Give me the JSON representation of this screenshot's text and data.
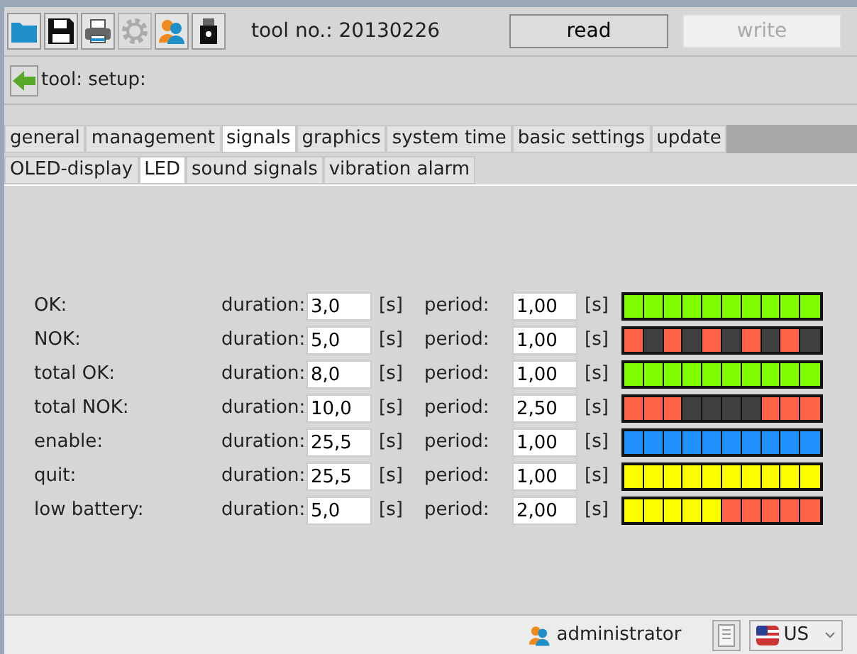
{
  "toolbar": {
    "buttons": [
      {
        "kind": "folder",
        "disabled": false
      },
      {
        "kind": "save",
        "disabled": false
      },
      {
        "kind": "print",
        "disabled": false
      },
      {
        "kind": "gear",
        "disabled": true
      },
      {
        "kind": "user",
        "disabled": false
      },
      {
        "kind": "usb",
        "disabled": false
      }
    ],
    "tool_no": "tool no.: 20130226",
    "actions": [
      {
        "label": "read",
        "disabled": false
      },
      {
        "label": "write",
        "disabled": true
      }
    ]
  },
  "breadcrumb": "tool: setup:",
  "tabs": [
    {
      "label": "general",
      "selected": false
    },
    {
      "label": "management",
      "selected": false
    },
    {
      "label": "signals",
      "selected": true
    },
    {
      "label": "graphics",
      "selected": false
    },
    {
      "label": "system time",
      "selected": false
    },
    {
      "label": "basic settings",
      "selected": false
    },
    {
      "label": "update",
      "selected": false
    }
  ],
  "subtabs": [
    {
      "label": "OLED-display",
      "selected": false
    },
    {
      "label": "LED",
      "selected": true
    },
    {
      "label": "sound signals",
      "selected": false
    },
    {
      "label": "vibration alarm",
      "selected": false
    }
  ],
  "signals": [
    {
      "name": "OK:",
      "duration_label": "duration:",
      "duration": "3,0",
      "duration_unit": "[s]",
      "period_label": "period:",
      "period": "1,00",
      "period_unit": "[s]",
      "cells": [
        {
          "color": "#7fff00"
        },
        {
          "color": "#7fff00"
        },
        {
          "color": "#7fff00"
        },
        {
          "color": "#7fff00"
        },
        {
          "color": "#7fff00"
        },
        {
          "color": "#7fff00"
        },
        {
          "color": "#7fff00"
        },
        {
          "color": "#7fff00"
        },
        {
          "color": "#7fff00"
        },
        {
          "color": "#7fff00"
        }
      ]
    },
    {
      "name": "NOK:",
      "duration_label": "duration:",
      "duration": "5,0",
      "duration_unit": "[s]",
      "period_label": "period:",
      "period": "1,00",
      "period_unit": "[s]",
      "cells": [
        {
          "color": "#ff6347"
        },
        {
          "color": "#404040"
        },
        {
          "color": "#ff6347"
        },
        {
          "color": "#404040"
        },
        {
          "color": "#ff6347"
        },
        {
          "color": "#404040"
        },
        {
          "color": "#ff6347"
        },
        {
          "color": "#404040"
        },
        {
          "color": "#ff6347"
        },
        {
          "color": "#404040"
        }
      ]
    },
    {
      "name": "total OK:",
      "duration_label": "duration:",
      "duration": "8,0",
      "duration_unit": "[s]",
      "period_label": "period:",
      "period": "1,00",
      "period_unit": "[s]",
      "cells": [
        {
          "color": "#7fff00"
        },
        {
          "color": "#7fff00"
        },
        {
          "color": "#7fff00"
        },
        {
          "color": "#7fff00"
        },
        {
          "color": "#7fff00"
        },
        {
          "color": "#7fff00"
        },
        {
          "color": "#7fff00"
        },
        {
          "color": "#7fff00"
        },
        {
          "color": "#7fff00"
        },
        {
          "color": "#7fff00"
        }
      ]
    },
    {
      "name": "total NOK:",
      "duration_label": "duration:",
      "duration": "10,0",
      "duration_unit": "[s]",
      "period_label": "period:",
      "period": "2,50",
      "period_unit": "[s]",
      "cells": [
        {
          "color": "#ff6347"
        },
        {
          "color": "#ff6347"
        },
        {
          "color": "#ff6347"
        },
        {
          "color": "#404040"
        },
        {
          "color": "#404040"
        },
        {
          "color": "#404040"
        },
        {
          "color": "#404040"
        },
        {
          "color": "#ff6347"
        },
        {
          "color": "#ff6347"
        },
        {
          "color": "#ff6347"
        }
      ]
    },
    {
      "name": "enable:",
      "duration_label": "duration:",
      "duration": "25,5",
      "duration_unit": "[s]",
      "period_label": "period:",
      "period": "1,00",
      "period_unit": "[s]",
      "cells": [
        {
          "color": "#1e90ff"
        },
        {
          "color": "#1e90ff"
        },
        {
          "color": "#1e90ff"
        },
        {
          "color": "#1e90ff"
        },
        {
          "color": "#1e90ff"
        },
        {
          "color": "#1e90ff"
        },
        {
          "color": "#1e90ff"
        },
        {
          "color": "#1e90ff"
        },
        {
          "color": "#1e90ff"
        },
        {
          "color": "#1e90ff"
        }
      ]
    },
    {
      "name": "quit:",
      "duration_label": "duration:",
      "duration": "25,5",
      "duration_unit": "[s]",
      "period_label": "period:",
      "period": "1,00",
      "period_unit": "[s]",
      "cells": [
        {
          "color": "#ffff00"
        },
        {
          "color": "#ffff00"
        },
        {
          "color": "#ffff00"
        },
        {
          "color": "#ffff00"
        },
        {
          "color": "#ffff00"
        },
        {
          "color": "#ffff00"
        },
        {
          "color": "#ffff00"
        },
        {
          "color": "#ffff00"
        },
        {
          "color": "#ffff00"
        },
        {
          "color": "#ffff00"
        }
      ]
    },
    {
      "name": "low battery:",
      "duration_label": "duration:",
      "duration": "5,0",
      "duration_unit": "[s]",
      "period_label": "period:",
      "period": "2,00",
      "period_unit": "[s]",
      "cells": [
        {
          "color": "#ffff00"
        },
        {
          "color": "#ffff00"
        },
        {
          "color": "#ffff00"
        },
        {
          "color": "#ffff00"
        },
        {
          "color": "#ffff00"
        },
        {
          "color": "#ff6347"
        },
        {
          "color": "#ff6347"
        },
        {
          "color": "#ff6347"
        },
        {
          "color": "#ff6347"
        },
        {
          "color": "#ff6347"
        }
      ]
    }
  ],
  "status_bar": {
    "user": "administrator",
    "language": "US"
  }
}
